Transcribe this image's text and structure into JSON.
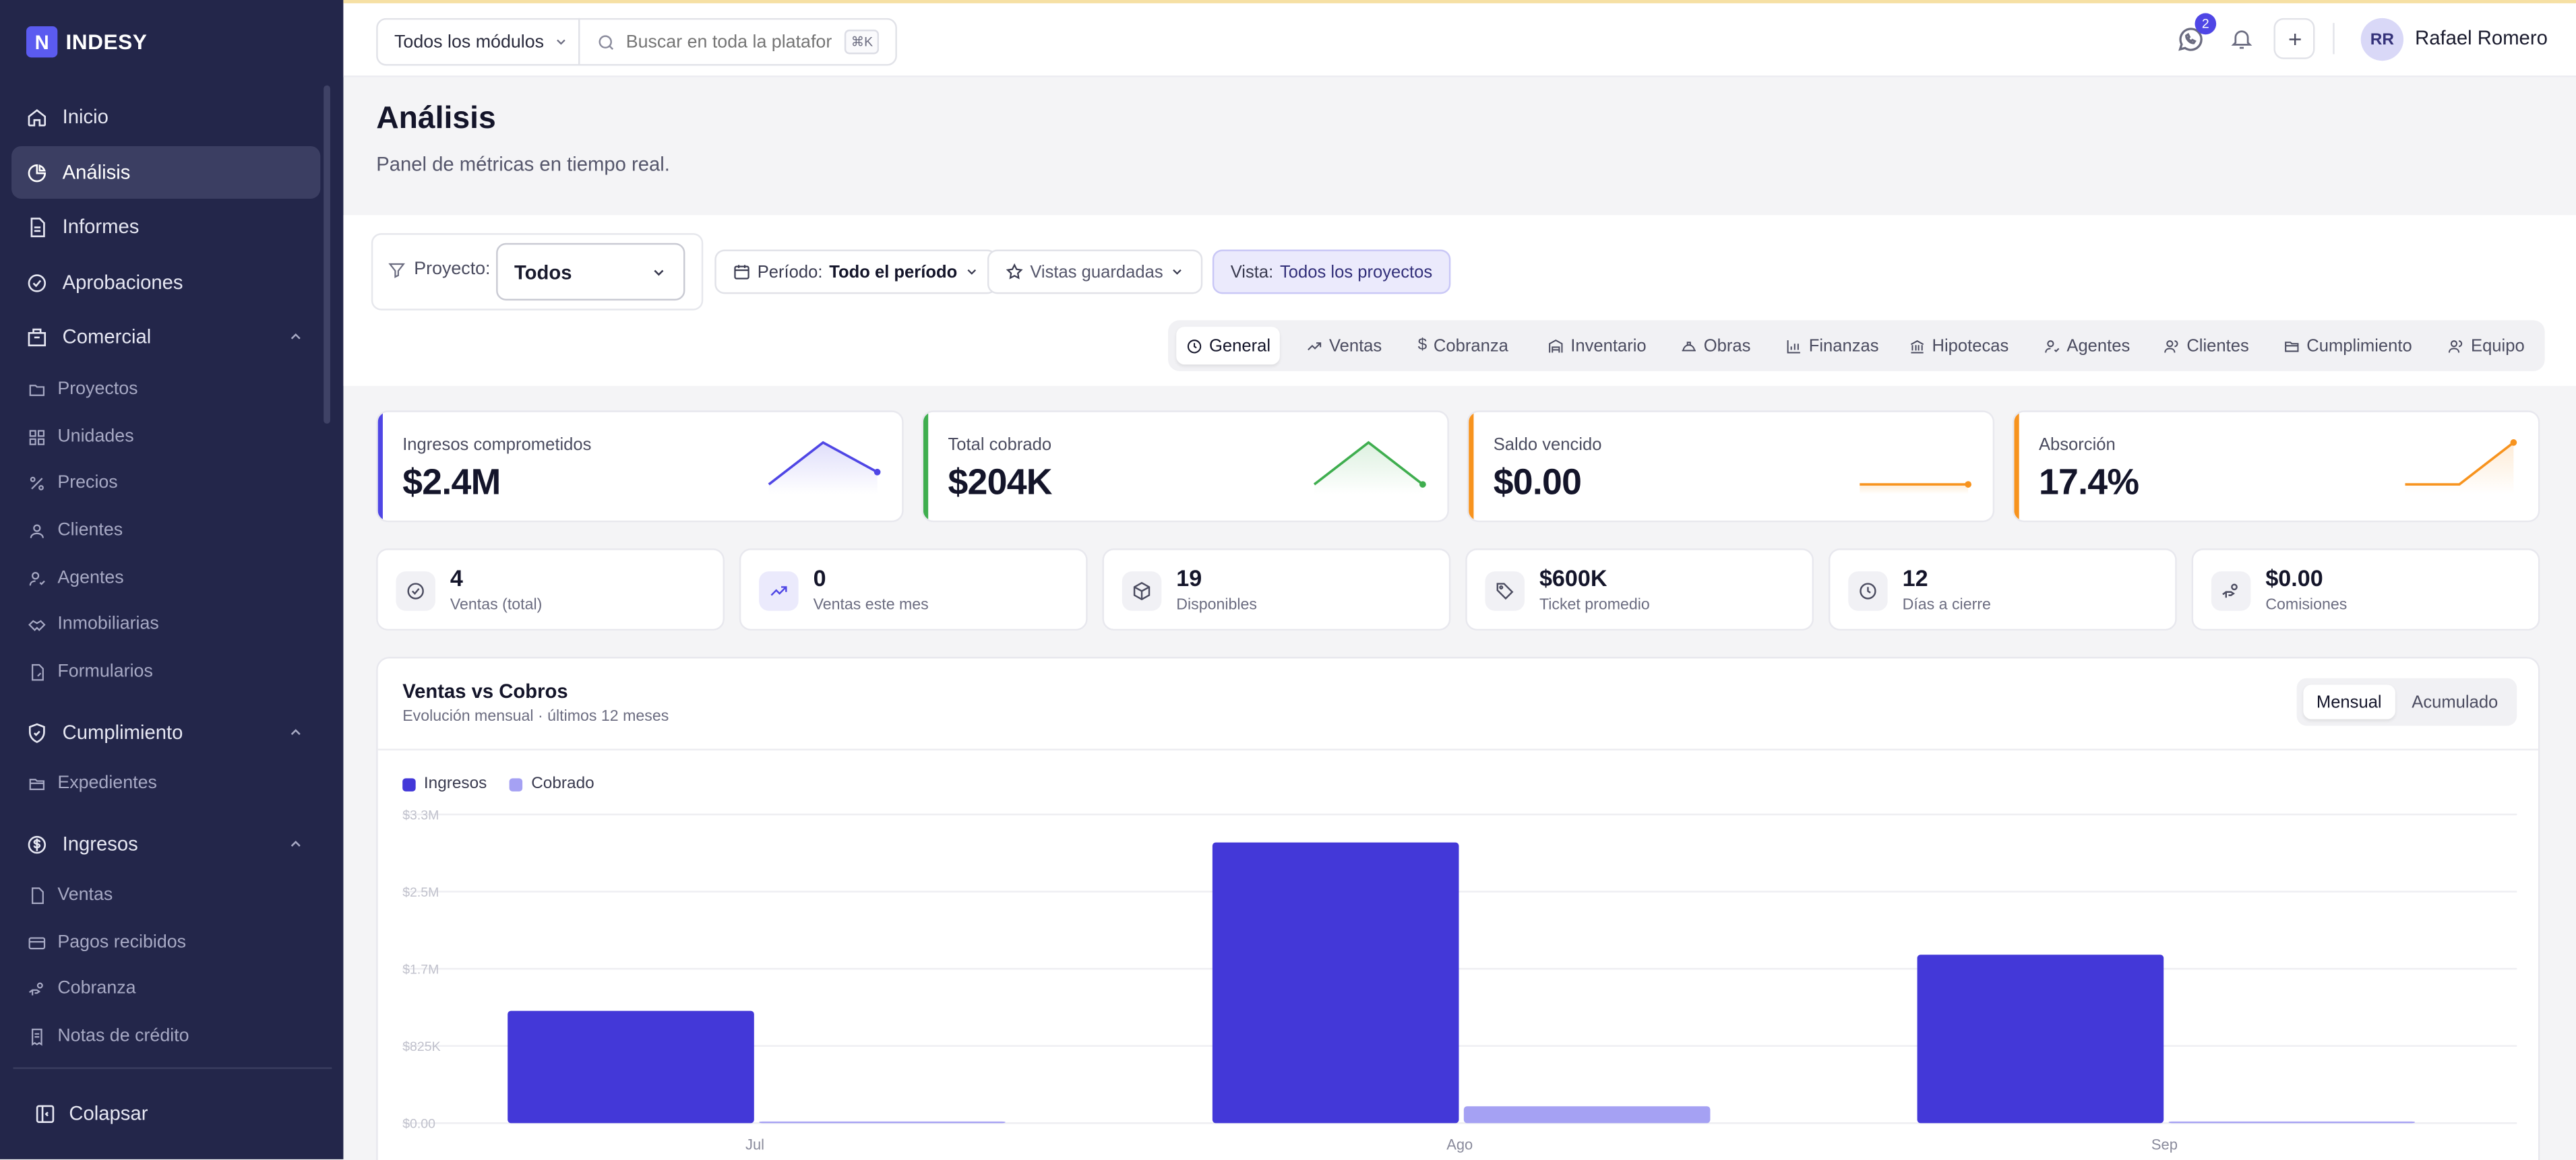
{
  "brand": {
    "logo_glyph": "N",
    "name": "INDESY"
  },
  "sidebar": {
    "items": [
      {
        "id": "inicio",
        "label": "Inicio",
        "icon": "home-icon"
      },
      {
        "id": "analisis",
        "label": "Análisis",
        "icon": "pie-chart-icon",
        "active": true
      },
      {
        "id": "informes",
        "label": "Informes",
        "icon": "file-text-icon"
      },
      {
        "id": "aprobaciones",
        "label": "Aprobaciones",
        "icon": "check-circle-icon"
      }
    ],
    "groups": [
      {
        "id": "comercial",
        "label": "Comercial",
        "icon": "building-icon",
        "expanded": true,
        "items": [
          {
            "label": "Proyectos",
            "icon": "folder-icon"
          },
          {
            "label": "Unidades",
            "icon": "grid-icon"
          },
          {
            "label": "Precios",
            "icon": "percent-icon"
          },
          {
            "label": "Clientes",
            "icon": "user-icon"
          },
          {
            "label": "Agentes",
            "icon": "user-check-icon"
          },
          {
            "label": "Inmobiliarias",
            "icon": "handshake-icon"
          },
          {
            "label": "Formularios",
            "icon": "form-icon"
          }
        ]
      },
      {
        "id": "cumplimiento",
        "label": "Cumplimiento",
        "icon": "shield-check-icon",
        "expanded": true,
        "items": [
          {
            "label": "Expedientes",
            "icon": "folder-open-icon"
          }
        ]
      },
      {
        "id": "ingresos",
        "label": "Ingresos",
        "icon": "dollar-circle-icon",
        "expanded": true,
        "items": [
          {
            "label": "Ventas",
            "icon": "file-icon"
          },
          {
            "label": "Pagos recibidos",
            "icon": "credit-card-icon"
          },
          {
            "label": "Cobranza",
            "icon": "hand-coins-icon"
          },
          {
            "label": "Notas de crédito",
            "icon": "receipt-icon"
          }
        ]
      }
    ],
    "collapse_label": "Colapsar"
  },
  "topbar": {
    "module_select": "Todos los módulos",
    "search_placeholder": "Buscar en toda la platafor",
    "search_shortcut": "⌘K",
    "whatsapp_badge": "2",
    "user_initials": "RR",
    "user_name": "Rafael Romero"
  },
  "page": {
    "title": "Análisis",
    "subtitle": "Panel de métricas en tiempo real."
  },
  "filters": {
    "project_label": "Proyecto:",
    "project_value": "Todos",
    "period_label": "Período:",
    "period_value": "Todo el período",
    "saved_views": "Vistas guardadas",
    "view_label": "Vista:",
    "view_value": "Todos los proyectos"
  },
  "tabs": [
    {
      "label": "General",
      "icon": "clock-icon",
      "active": true
    },
    {
      "label": "Ventas",
      "icon": "trending-up-icon"
    },
    {
      "label": "Cobranza",
      "icon": "dollar-icon"
    },
    {
      "label": "Inventario",
      "icon": "warehouse-icon"
    },
    {
      "label": "Obras",
      "icon": "hard-hat-icon"
    },
    {
      "label": "Finanzas",
      "icon": "bar-chart-icon"
    },
    {
      "label": "Hipotecas",
      "icon": "bank-icon"
    },
    {
      "label": "Agentes",
      "icon": "user-check-icon"
    },
    {
      "label": "Clientes",
      "icon": "users-icon"
    },
    {
      "label": "Cumplimiento",
      "icon": "folder-open-icon"
    },
    {
      "label": "Equipo",
      "icon": "users-icon"
    }
  ],
  "kpis": [
    {
      "label": "Ingresos comprometidos",
      "value": "$2.4M",
      "color": "#4f46e5",
      "trend": [
        0.1,
        0.95,
        0.35
      ]
    },
    {
      "label": "Total cobrado",
      "value": "$204K",
      "color": "#3fae4f",
      "trend": [
        0.1,
        0.95,
        0.1
      ]
    },
    {
      "label": "Saldo vencido",
      "value": "$0.00",
      "color": "#f7931e",
      "trend": [
        0.1,
        0.1,
        0.1
      ]
    },
    {
      "label": "Absorción",
      "value": "17.4%",
      "color": "#f7931e",
      "trend": [
        0.1,
        0.1,
        0.95
      ]
    }
  ],
  "stats": [
    {
      "value": "4",
      "label": "Ventas (total)",
      "icon": "check-circle-icon"
    },
    {
      "value": "0",
      "label": "Ventas este mes",
      "icon": "trending-up-icon"
    },
    {
      "value": "19",
      "label": "Disponibles",
      "icon": "box-icon"
    },
    {
      "value": "$600K",
      "label": "Ticket promedio",
      "icon": "tag-icon"
    },
    {
      "value": "12",
      "label": "Días a cierre",
      "icon": "clock-icon"
    },
    {
      "value": "$0.00",
      "label": "Comisiones",
      "icon": "hand-coins-icon"
    }
  ],
  "chart_section": {
    "title": "Ventas vs Cobros",
    "subtitle": "Evolución mensual · últimos 12 meses",
    "toggle": [
      "Mensual",
      "Acumulado"
    ],
    "active_toggle": "Mensual"
  },
  "chart_data": {
    "type": "bar",
    "categories": [
      "Jul",
      "Ago",
      "Sep"
    ],
    "series": [
      {
        "name": "Ingresos",
        "color": "#4338d8",
        "values": [
          1200000,
          3000000,
          1800000
        ]
      },
      {
        "name": "Cobrado",
        "color": "#a5a1f3",
        "values": [
          10000,
          180000,
          10000
        ]
      }
    ],
    "yticks": [
      "$0.00",
      "$825K",
      "$1.7M",
      "$2.5M",
      "$3.3M"
    ],
    "ytick_values": [
      0,
      825000,
      1650000,
      2475000,
      3300000
    ],
    "ylim": [
      0,
      3300000
    ],
    "grid": true,
    "legend_position": "top-left"
  }
}
